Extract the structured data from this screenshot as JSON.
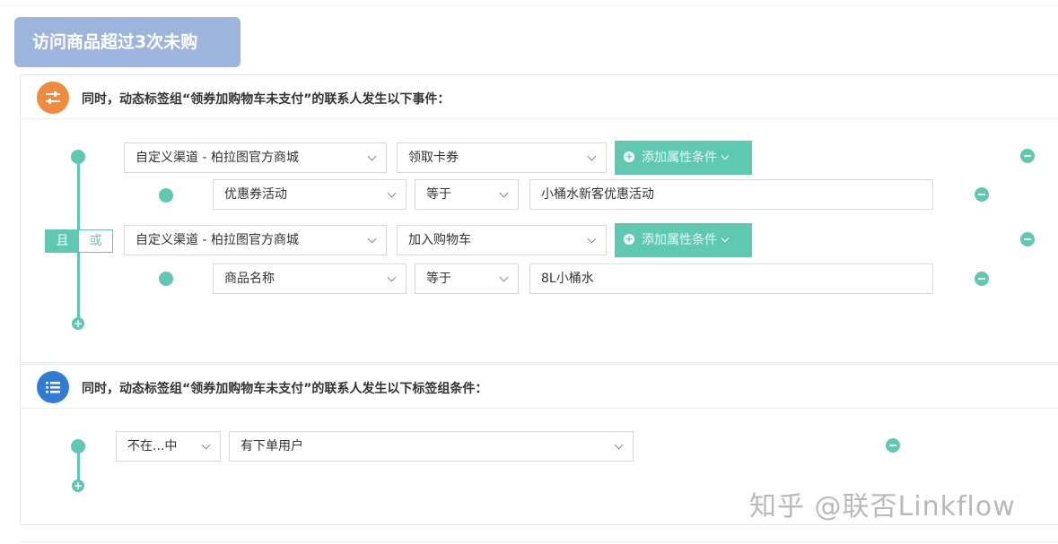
{
  "header": {
    "title": "访问商品超过3次未购"
  },
  "event_section": {
    "description": "同时，动态标签组“领券加购物车未支付”的联系人发生以下事件：",
    "icon": "sliders-icon",
    "icon_color": "#f08a3c",
    "logic_toggle": {
      "and_label": "且",
      "or_label": "或",
      "selected": "且"
    },
    "events": [
      {
        "channel": "自定义渠道 - 柏拉图官方商城",
        "event": "领取卡券",
        "add_condition_label": "添加属性条件",
        "condition": {
          "property": "优惠券活动",
          "operator": "等于",
          "value": "小桶水新客优惠活动"
        }
      },
      {
        "channel": "自定义渠道 - 柏拉图官方商城",
        "event": "加入购物车",
        "add_condition_label": "添加属性条件",
        "condition": {
          "property": "商品名称",
          "operator": "等于",
          "value": "8L小桶水"
        }
      }
    ]
  },
  "tag_section": {
    "description": "同时，动态标签组“领券加购物车未支付”的联系人发生以下标签组条件：",
    "icon": "list-icon",
    "icon_color": "#2f7bd6",
    "condition": {
      "operator": "不在...中",
      "tag": "有下单用户"
    }
  },
  "watermark": "知乎 @联否Linkflow",
  "accent_color": "#5fc8b0"
}
